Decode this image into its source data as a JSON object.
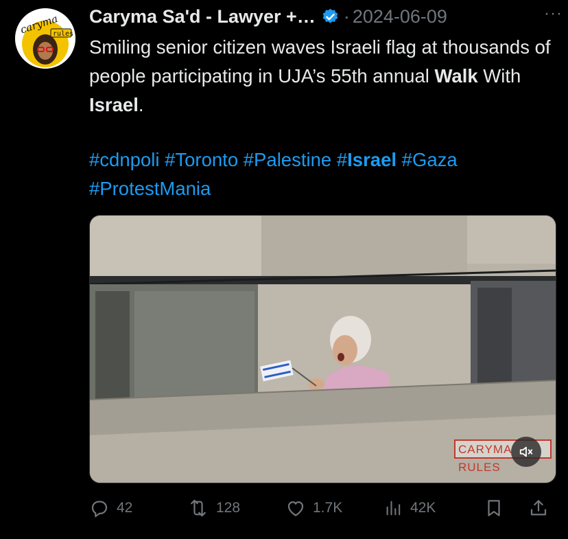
{
  "author": {
    "name": "Caryma Sa'd - Lawyer +…",
    "verified": true,
    "avatar_text_top": "caryma",
    "avatar_text_bottom": "rules"
  },
  "post": {
    "date_sep": "·",
    "date": "2024-06-09",
    "more": "···",
    "text_part1": "Smiling senior citizen waves Israeli flag at thousands of people participating in UJA’s 55th annual ",
    "text_bold1": "Walk",
    "text_part2": " With ",
    "text_bold2": "Israel",
    "text_part3": ".",
    "hashtags": {
      "h1": "#cdnpoli",
      "h2": "#Toronto",
      "h3": "#Palestine",
      "h4_prefix": "#",
      "h4_bold": "Israel",
      "h5": "#Gaza",
      "h6": "#ProtestMania"
    }
  },
  "media": {
    "watermark": "CARYMA RULES"
  },
  "actions": {
    "replies": "42",
    "reposts": "128",
    "likes": "1.7K",
    "views": "42K"
  },
  "colors": {
    "link": "#1d9bf0",
    "muted": "#71767b",
    "background": "#000000"
  }
}
